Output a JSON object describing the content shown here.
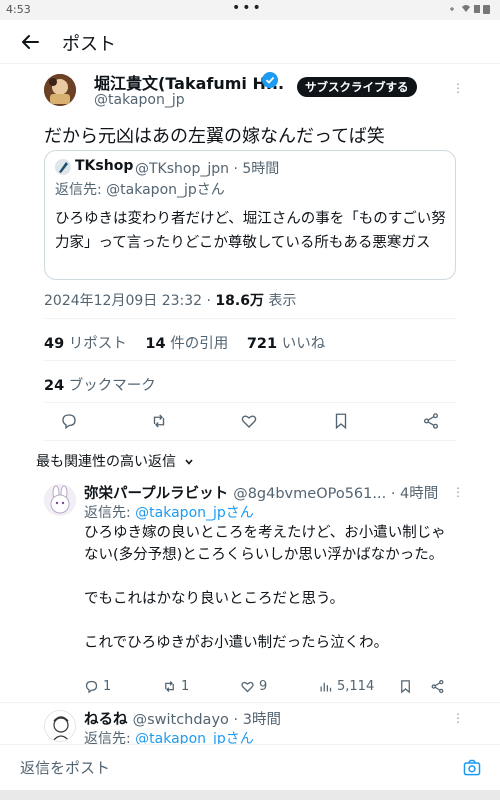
{
  "status_bar": {
    "time": "4:53",
    "dots": "•••"
  },
  "header": {
    "title": "ポスト"
  },
  "post": {
    "author_name": "堀江貴文(Takafumi H...",
    "handle": "@takapon_jp",
    "subscribe_label": "サブスクライブする",
    "text": "だから元凶はあの左翼の嫁なんだってば笑",
    "timestamp": "2024年12月09日 23:32",
    "views_count": "18.6万",
    "views_label": "表示",
    "stats": {
      "reposts_count": "49",
      "reposts_label": "リポスト",
      "quotes_count": "14",
      "quotes_label": "件の引用",
      "likes_count": "721",
      "likes_label": "いいね",
      "bookmarks_count": "24",
      "bookmarks_label": "ブックマーク"
    }
  },
  "quote": {
    "name": "TKshop",
    "meta": "@TKshop_jpn · 5時間",
    "reply_prefix": "返信先: ",
    "reply_handle": "@takapon_jp",
    "reply_suffix": "さん",
    "body": "ひろゆきは変わり者だけど、堀江さんの事を「ものすごい努力家」って言ったりどこか尊敬している所もある悪寒ガス"
  },
  "sort": {
    "label": "最も関連性の高い返信"
  },
  "replies": [
    {
      "name": "弥栄パープルラビット",
      "meta": "@8g4bvmeOPo561... · 4時間",
      "reply_prefix": "返信先: ",
      "reply_handle": "@takapon_jpさん",
      "lines": [
        "ひろゆき嫁の良いところを考えたけど、お小遣い制じゃない(多分予想)ところくらいしか思い浮かばなかった。",
        "",
        "でもこれはかなり良いところだと思う。",
        "",
        "これでひろゆきがお小遣い制だったら泣くわ。"
      ],
      "replies_count": "1",
      "reposts_count": "1",
      "likes_count": "9",
      "views_count": "5,114"
    },
    {
      "name": "ねるね",
      "meta": "@switchdayo · 3時間",
      "reply_prefix": "返信先: ",
      "reply_handle": "@takapon_jpさん"
    }
  ],
  "reply_bar": {
    "placeholder": "返信をポスト"
  },
  "colors": {
    "accent": "#1d9bf0",
    "text": "#0f1419",
    "muted": "#536471",
    "border": "#cfd9de"
  }
}
